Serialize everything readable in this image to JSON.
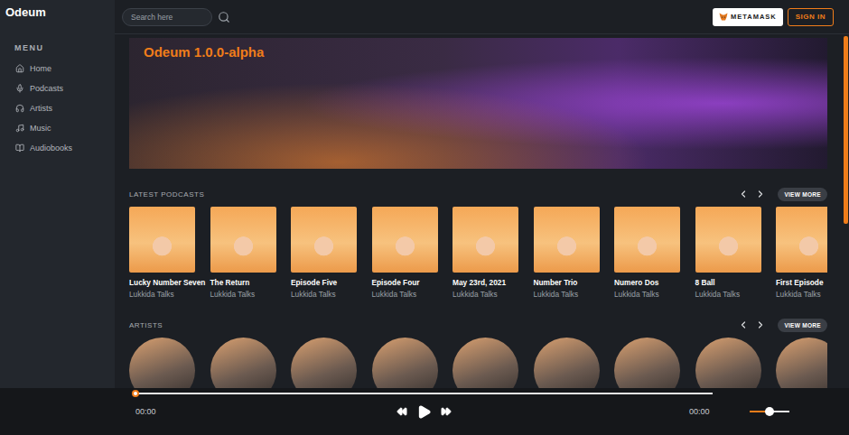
{
  "app": {
    "name": "Odeum"
  },
  "sidebar": {
    "heading": "MENU",
    "items": [
      {
        "label": "Home"
      },
      {
        "label": "Podcasts"
      },
      {
        "label": "Artists"
      },
      {
        "label": "Music"
      },
      {
        "label": "Audiobooks"
      }
    ]
  },
  "search": {
    "placeholder": "Search here"
  },
  "header_buttons": {
    "wallet": "METAMASK",
    "sign_in": "SIGN IN"
  },
  "banner": {
    "title": "Odeum 1.0.0-alpha"
  },
  "podcasts": {
    "title": "LATEST PODCASTS",
    "view_more": "VIEW MORE",
    "items": [
      {
        "title": "Lucky Number Seven",
        "author": "Lukkida Talks"
      },
      {
        "title": "The Return",
        "author": "Lukkida Talks"
      },
      {
        "title": "Episode Five",
        "author": "Lukkida Talks"
      },
      {
        "title": "Episode Four",
        "author": "Lukkida Talks"
      },
      {
        "title": "May 23rd, 2021",
        "author": "Lukkida Talks"
      },
      {
        "title": "Number Trio",
        "author": "Lukkida Talks"
      },
      {
        "title": "Numero Dos",
        "author": "Lukkida Talks"
      },
      {
        "title": "8 Ball",
        "author": "Lukkida Talks"
      },
      {
        "title": "First Episode",
        "author": "Lukkida Talks"
      }
    ]
  },
  "artists": {
    "title": "ARTISTS",
    "view_more": "VIEW MORE",
    "items": [
      {},
      {},
      {},
      {},
      {},
      {},
      {},
      {},
      {}
    ]
  },
  "player": {
    "elapsed": "00:00",
    "duration": "00:00",
    "level": 0,
    "volume": {
      "level": 0.5
    }
  },
  "scrollbar": {
    "level": 0.47
  }
}
